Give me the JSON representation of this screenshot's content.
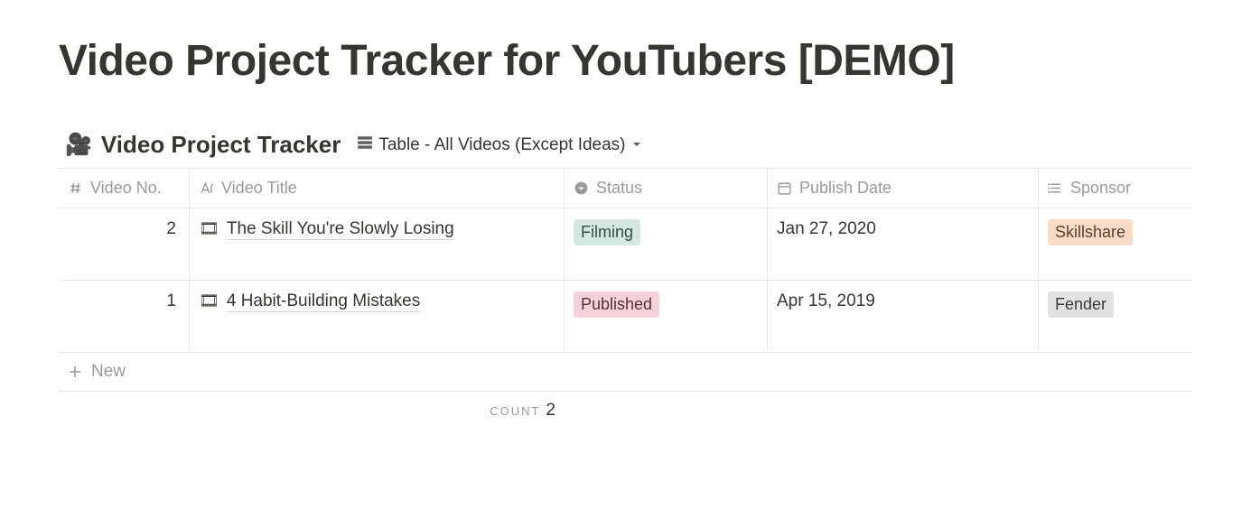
{
  "page": {
    "title": "Video Project Tracker for YouTubers [DEMO]"
  },
  "database": {
    "emoji": "🎥",
    "title": "Video Project Tracker",
    "view": "Table - All Videos (Except Ideas)"
  },
  "columns": {
    "video_no": "Video No.",
    "video_title": "Video Title",
    "status": "Status",
    "publish_date": "Publish Date",
    "sponsor": "Sponsor"
  },
  "rows": [
    {
      "video_no": "2",
      "emoji": "🎞",
      "title": "The Skill You're Slowly Losing",
      "status": "Filming",
      "status_class": "tag-filming",
      "publish_date": "Jan 27, 2020",
      "sponsor": "Skillshare",
      "sponsor_class": "tag-skillshare"
    },
    {
      "video_no": "1",
      "emoji": "🎞",
      "title": "4 Habit-Building Mistakes",
      "status": "Published",
      "status_class": "tag-published",
      "publish_date": "Apr 15, 2019",
      "sponsor": "Fender",
      "sponsor_class": "tag-fender"
    }
  ],
  "new_label": "New",
  "footer": {
    "count_label": "COUNT",
    "count_value": "2"
  }
}
